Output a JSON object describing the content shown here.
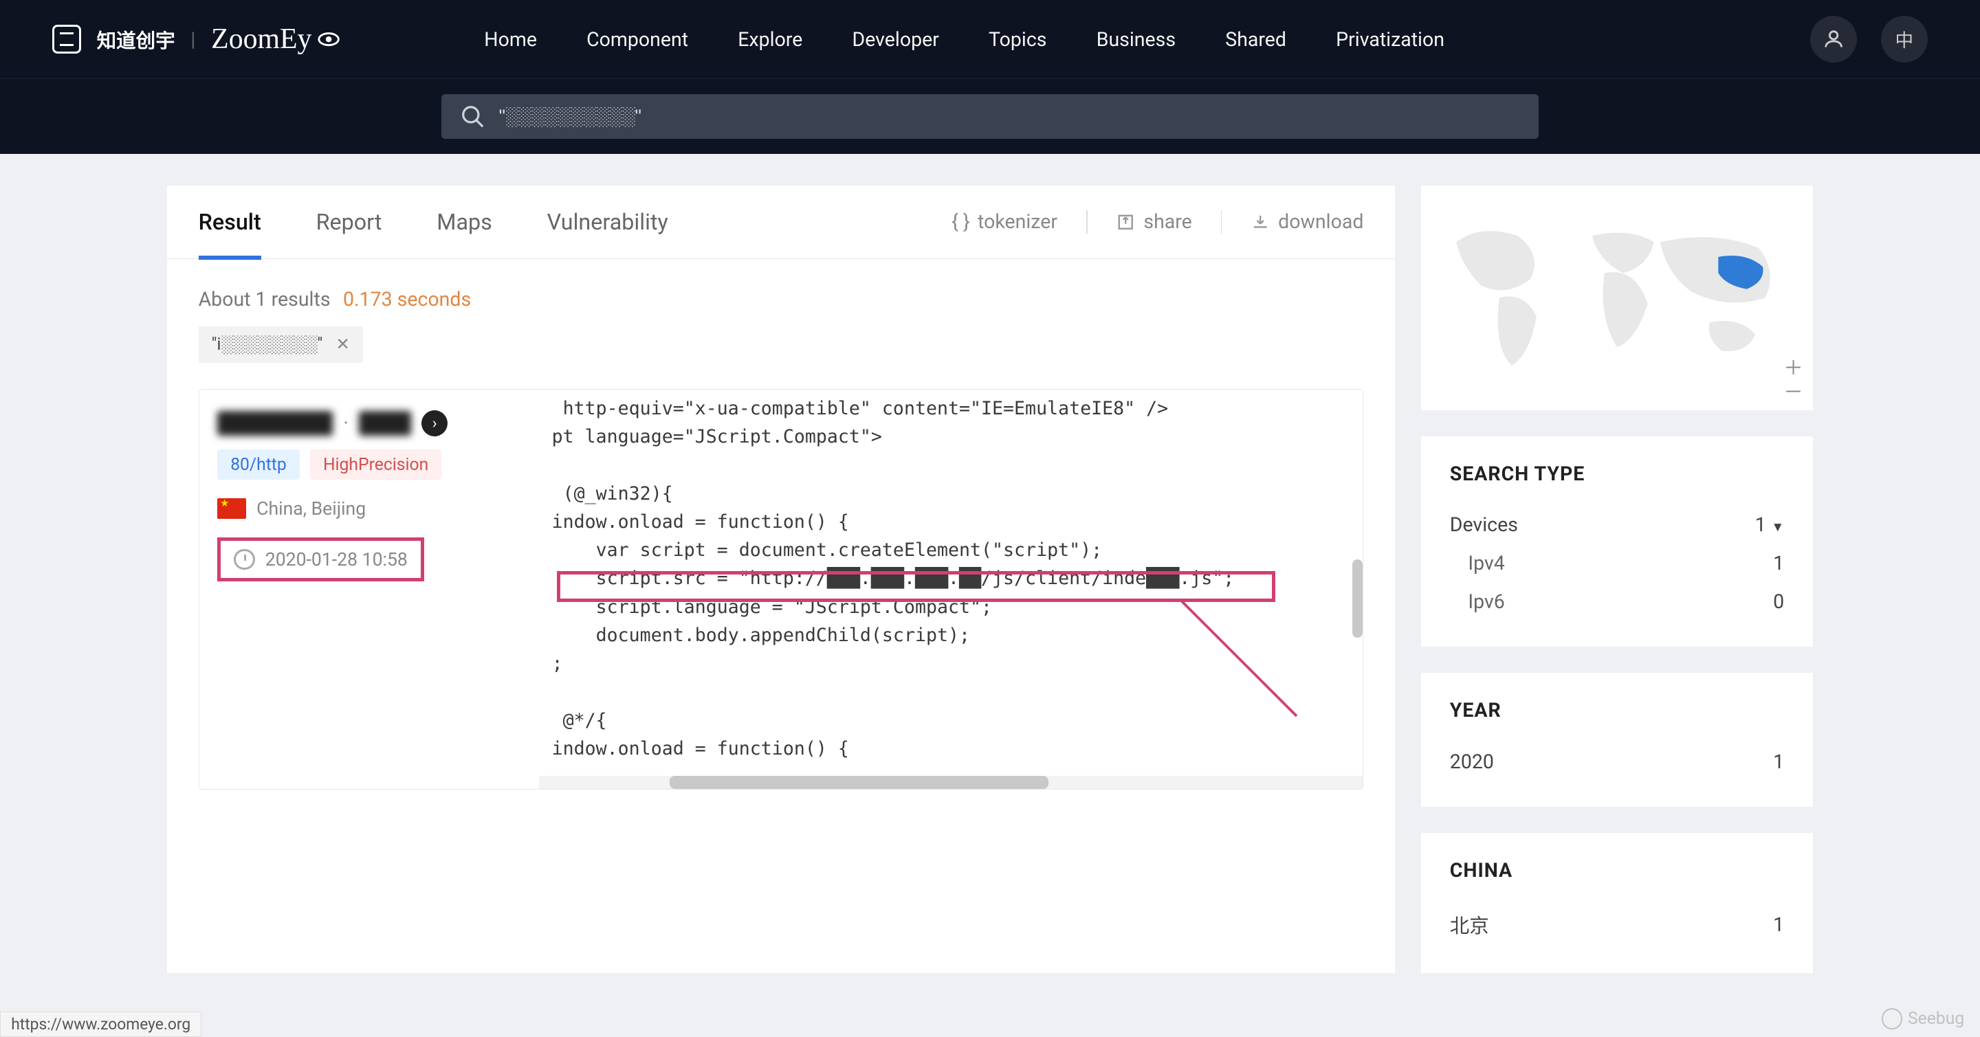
{
  "brand": {
    "company": "知道创宇",
    "product": "ZoomEy"
  },
  "nav": {
    "home": "Home",
    "component": "Component",
    "explore": "Explore",
    "developer": "Developer",
    "topics": "Topics",
    "business": "Business",
    "shared": "Shared",
    "privatization": "Privatization",
    "lang": "中"
  },
  "search": {
    "query": "\"░░░░░░░░░░\""
  },
  "tabs": {
    "result": "Result",
    "report": "Report",
    "maps": "Maps",
    "vulnerability": "Vulnerability"
  },
  "actions": {
    "tokenizer": "tokenizer",
    "share": "share",
    "download": "download"
  },
  "results": {
    "count_text": "About 1 results",
    "time_text": "0.173 seconds",
    "filter_chip": "\"i░░░░░░░░\"",
    "entry": {
      "host_masked": "███████",
      "port_badge": "80/http",
      "precision_badge": "HighPrecision",
      "location": "China, Beijing",
      "timestamp": "2020-01-28 10:58",
      "code_lines": [
        " http-equiv=\"x-ua-compatible\" content=\"IE=EmulateIE8\" />",
        "pt language=\"JScript.Compact\">",
        "",
        " (@_win32){",
        "indow.onload = function() {",
        "    var script = document.createElement(\"script\");",
        "    script.src = \"http://███.███.███.██/js/client/inde███.js\";",
        "    script.language = \"JScript.Compact\";",
        "    document.body.appendChild(script);",
        ";",
        "",
        " @*/{",
        "indow.onload = function() {"
      ]
    }
  },
  "sidebar": {
    "search_type": {
      "title": "SEARCH TYPE",
      "devices_label": "Devices",
      "devices_count": "1",
      "ipv4_label": "Ipv4",
      "ipv4_count": "1",
      "ipv6_label": "Ipv6",
      "ipv6_count": "0"
    },
    "year": {
      "title": "YEAR",
      "label": "2020",
      "count": "1"
    },
    "china": {
      "title": "CHINA",
      "label": "北京",
      "count": "1"
    }
  },
  "status_url": "https://www.zoomeye.org",
  "watermark": "Seebug"
}
